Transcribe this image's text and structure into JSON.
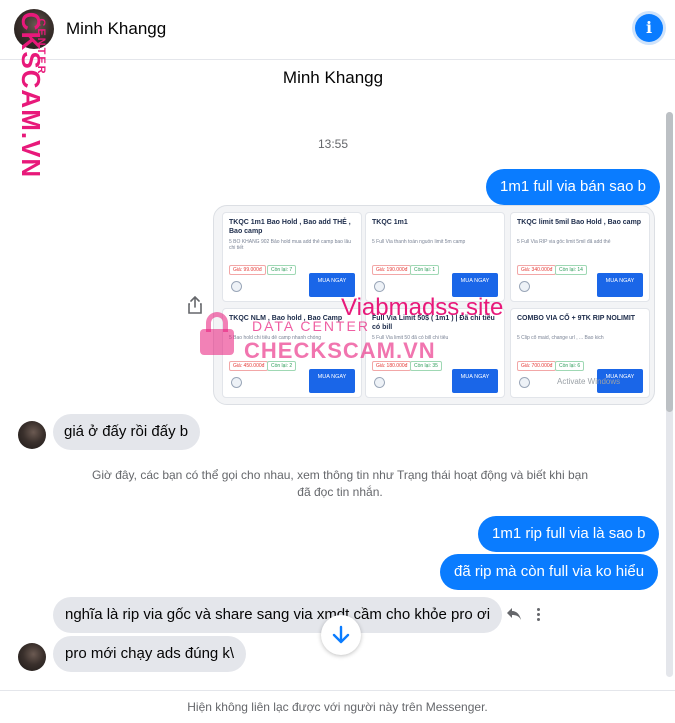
{
  "header": {
    "name": "Minh Khangg",
    "info_icon": "i"
  },
  "watermark_side": {
    "brand": "CKSCAM.VN",
    "tag": "CENTER"
  },
  "conversation": {
    "title": "Minh Khangg",
    "timestamp": "13:55"
  },
  "messages": {
    "m1": "1m1 full via bán sao b",
    "m2": "giá ở   đấy rồi đấy b",
    "m3": "1m1 rip full via là sao b",
    "m4": "đã rip mà còn full via ko hiểu",
    "m5": "nghĩa là rip via gốc và share sang via xmdt cầm cho khỏe pro ơi",
    "m6": "pro mới chạy ads đúng k\\"
  },
  "screenshot": {
    "cards": [
      {
        "title": "TKQC 1m1 Bao Hold , Bao add THẺ , Bao camp",
        "desc": "5 BỎ KHÁNG 902 Bảo hold mua add thẻ camp bao lâu chi tiết",
        "price": "Giá: 99.000đ",
        "stock": "Còn lại: 7",
        "buy": "MUA NGAY"
      },
      {
        "title": "TKQC 1m1",
        "desc": "5 Full Via thanh toán nguồn limit 5m camp",
        "price": "Giá: 190.000đ",
        "stock": "Còn lại: 1",
        "buy": "MUA NGAY"
      },
      {
        "title": "TKQC limit 5mil Bao Hold , Bao camp",
        "desc": "5 Full Via RIP via gốc limit 5mil đã add thẻ",
        "price": "Giá: 340.000đ",
        "stock": "Còn lại: 14",
        "buy": "MUA NGAY"
      },
      {
        "title": "TKQC NLM , Bao hold , Bao Camp",
        "desc": "5 Bao hold chi tiêu dễ camp nhanh chóng",
        "price": "Giá: 450.000đ",
        "stock": "Còn lại: 2",
        "buy": "MUA NGAY"
      },
      {
        "title": "Full Via Limit 50$ ( 1m1 ) | Đã chi tiêu có bill",
        "desc": "5 Full Via limit 50 đã có bill chi tiêu",
        "price": "Giá: 180.000đ",
        "stock": "Còn lại: 35",
        "buy": "MUA NGAY"
      },
      {
        "title": "COMBO VIA CỔ + 9TK RIP NOLIMIT",
        "desc": "5 Clip cổ maid, change url , ... Bao kich",
        "price": "Giá: 700.000đ",
        "stock": "Còn lại: 6",
        "buy": "MUA NGAY"
      }
    ],
    "watermark_site": "Viabmadss.site",
    "watermark_data": "DATA CENTER",
    "watermark_brand": "CHECKSCAM.VN",
    "activate": "Activate Windows"
  },
  "notice": "Giờ đây, các bạn có thể gọi cho nhau, xem thông tin như Trạng thái hoạt động và biết khi bạn đã đọc tin nhắn.",
  "footer": "Hiện không liên lạc được với người này trên Messenger.",
  "colors": {
    "accent": "#0a7cff",
    "incoming": "#e4e6eb",
    "watermark": "#e8197a"
  }
}
